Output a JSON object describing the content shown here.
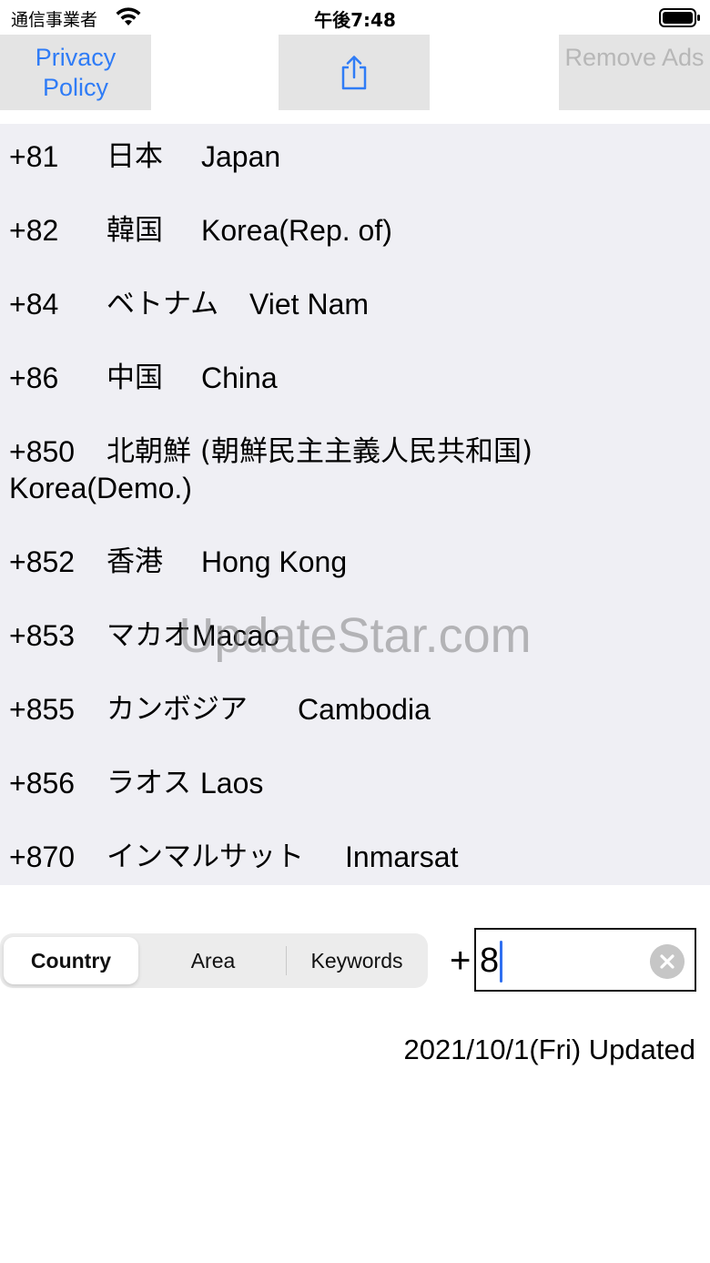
{
  "status_bar": {
    "carrier": "通信事業者",
    "time": "午後7:48",
    "icons": [
      "wifi-icon",
      "battery-icon"
    ]
  },
  "toolbar": {
    "privacy_label": "Privacy Policy",
    "share_icon": "share-icon",
    "remove_ads_label": "Remove Ads"
  },
  "results": [
    {
      "code": "+81",
      "ja": "日本",
      "en": "Japan"
    },
    {
      "code": "+82",
      "ja": "韓国",
      "en": "Korea(Rep. of)"
    },
    {
      "code": "+84",
      "ja": "ベトナム",
      "en": "Viet Nam"
    },
    {
      "code": "+86",
      "ja": "中国",
      "en": "China"
    },
    {
      "code": "+850",
      "ja": "北朝鮮 (朝鮮民主主義人民共和国)",
      "en": "Korea(Demo.)"
    },
    {
      "code": "+852",
      "ja": "香港",
      "en": "Hong Kong"
    },
    {
      "code": "+853",
      "ja": "マカオ",
      "en": "Macao"
    },
    {
      "code": "+855",
      "ja": "カンボジア",
      "en": "Cambodia"
    },
    {
      "code": "+856",
      "ja": "ラオス",
      "en": "Laos"
    },
    {
      "code": "+870",
      "ja": "インマルサット",
      "en": "Inmarsat"
    }
  ],
  "watermark": "UpdateStar.com",
  "search_mode": {
    "options": [
      "Country",
      "Area",
      "Keywords"
    ],
    "selected": "Country"
  },
  "code_input": {
    "prefix": "+",
    "value": "8"
  },
  "updated_text": "2021/10/1(Fri) Updated",
  "colors": {
    "accent": "#2f7cf6",
    "disabled": "#b7b7b7",
    "list_background": "#efeff4",
    "toolbar_button": "#e4e4e4"
  }
}
